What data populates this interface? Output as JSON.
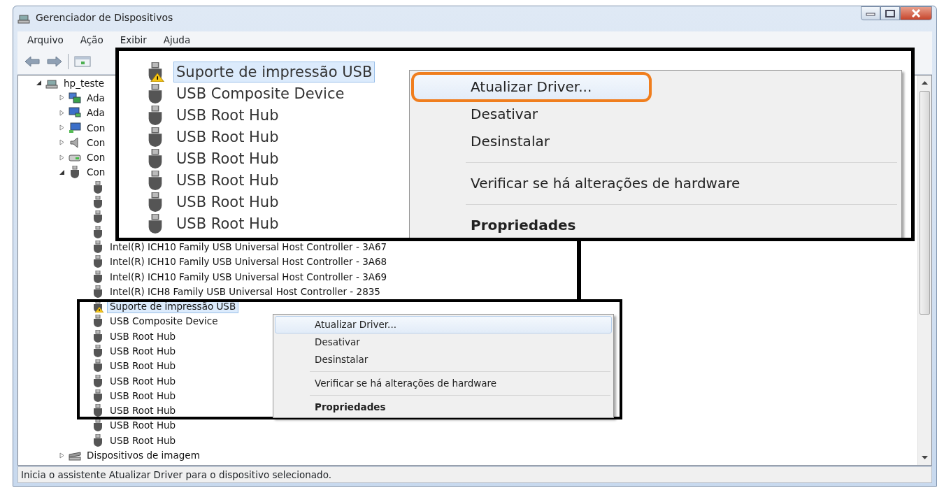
{
  "window": {
    "title": "Gerenciador de Dispositivos"
  },
  "menu": [
    "Arquivo",
    "Ação",
    "Exibir",
    "Ajuda"
  ],
  "tree": [
    {
      "label": "hp_teste",
      "expanded": true,
      "selected": false,
      "children": [
        {
          "label": "Ada",
          "expanded": false,
          "selected": false
        },
        {
          "label": "Ada",
          "expanded": false,
          "selected": false
        },
        {
          "label": "Con",
          "expanded": false,
          "selected": false
        },
        {
          "label": "Con",
          "expanded": false,
          "selected": false
        },
        {
          "label": "Con",
          "expanded": false,
          "selected": false
        },
        {
          "label": "Con",
          "expanded": true,
          "selected": false,
          "children": [
            {
              "selected": false
            },
            {
              "selected": false
            },
            {
              "selected": false
            },
            {
              "selected": false
            },
            {
              "label": "Intel(R) ICH10 Family USB Universal Host Controller - 3A67",
              "selected": false
            },
            {
              "label": "Intel(R) ICH10 Family USB Universal Host Controller - 3A68",
              "selected": false
            },
            {
              "label": "Intel(R) ICH10 Family USB Universal Host Controller - 3A69",
              "selected": false
            },
            {
              "label": "Intel(R) ICH8 Family USB Universal Host Controller - 2835",
              "selected": false
            },
            {
              "label": "Suporte de impressão USB",
              "warning": true,
              "selected": true
            },
            {
              "label": "USB Composite Device",
              "selected": false
            },
            {
              "label": "USB Root Hub",
              "selected": false
            },
            {
              "label": "USB Root Hub",
              "selected": false
            },
            {
              "label": "USB Root Hub",
              "selected": false
            },
            {
              "label": "USB Root Hub",
              "selected": false
            },
            {
              "label": "USB Root Hub",
              "selected": false
            },
            {
              "label": "USB Root Hub",
              "selected": false
            },
            {
              "label": "USB Root Hub",
              "selected": false
            },
            {
              "label": "USB Root Hub",
              "selected": false
            }
          ]
        },
        {
          "label": "Dispositivos de imagem",
          "expanded": false,
          "selected": false
        }
      ]
    }
  ],
  "context_menu": [
    {
      "kind": "item",
      "label": "Atualizar Driver...",
      "highlighted": true,
      "bold": false
    },
    {
      "kind": "item",
      "label": "Desativar",
      "highlighted": false,
      "bold": false
    },
    {
      "kind": "item",
      "label": "Desinstalar",
      "highlighted": false,
      "bold": false
    },
    {
      "kind": "separator"
    },
    {
      "kind": "item",
      "label": "Verificar se há alterações de hardware",
      "highlighted": false,
      "bold": false
    },
    {
      "kind": "separator"
    },
    {
      "kind": "item",
      "label": "Propriedades",
      "highlighted": false,
      "bold": true
    }
  ],
  "callout": {
    "rows": [
      {
        "label": "Suporte de impressão USB",
        "warning": true,
        "selected": true
      },
      {
        "label": "USB Composite Device",
        "selected": false
      },
      {
        "label": "USB Root Hub",
        "selected": false
      },
      {
        "label": "USB Root Hub",
        "selected": false
      },
      {
        "label": "USB Root Hub",
        "selected": false
      },
      {
        "label": "USB Root Hub",
        "selected": false
      },
      {
        "label": "USB Root Hub",
        "selected": false
      },
      {
        "label": "USB Root Hub",
        "selected": false
      }
    ],
    "context_menu": [
      {
        "kind": "item",
        "label": "Atualizar Driver...",
        "highlighted": true,
        "outlined": true,
        "bold": false
      },
      {
        "kind": "item",
        "label": "Desativar",
        "highlighted": false,
        "outlined": false,
        "bold": false
      },
      {
        "kind": "item",
        "label": "Desinstalar",
        "highlighted": false,
        "outlined": false,
        "bold": false
      },
      {
        "kind": "separator"
      },
      {
        "kind": "item",
        "label": "Verificar se há alterações de hardware",
        "highlighted": false,
        "outlined": false,
        "bold": false
      },
      {
        "kind": "separator"
      },
      {
        "kind": "item",
        "label": "Propriedades",
        "highlighted": false,
        "outlined": false,
        "bold": true
      }
    ]
  },
  "status_bar": "Inicia o assistente Atualizar Driver para o dispositivo selecionado."
}
